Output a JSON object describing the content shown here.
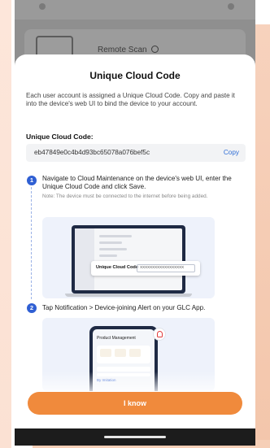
{
  "background": {
    "row_label": "Remote Scan",
    "info_icon": "info-icon"
  },
  "modal": {
    "title": "Unique Cloud Code",
    "description": "Each user account is assigned a Unique Cloud Code. Copy and paste it into the device's web UI to bind the device to your account.",
    "code_label": "Unique Cloud Code:",
    "code_value": "eb47849e0c4b4d93bc65078a076bef5c",
    "copy_label": "Copy",
    "steps": [
      {
        "number": "1",
        "text": "Navigate to Cloud Maintenance on the device's web UI, enter the Unique Cloud Code and click Save.",
        "note": "Note: The device must be connected to the internet before being added.",
        "illustration": {
          "popup_label": "Unique Cloud Code",
          "popup_value": "XXXXXXXXXXXXXXXXXX"
        }
      },
      {
        "number": "2",
        "text": "Tap Notification > Device-joining Alert on your GLC App.",
        "illustration": {
          "screen_title": "Product Management",
          "filter_text": "By Imitation",
          "icon": "bell-icon"
        }
      }
    ],
    "confirm_label": "I know"
  },
  "colors": {
    "accent": "#f08a3c",
    "step_badge": "#2f5fd3",
    "link": "#2f6ed6"
  }
}
